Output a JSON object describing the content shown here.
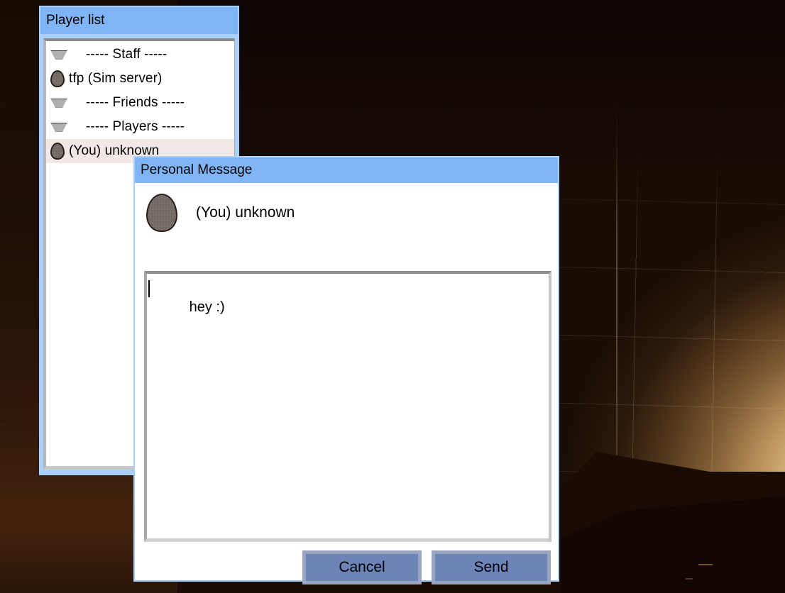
{
  "scene": {
    "description": "dark-brown-3d-room-with-warm-light",
    "colors": {
      "wall_dark": "#1b0d05",
      "wall_lit": "#efd8a8",
      "light_core": "#f7e6c0",
      "silhouette": "#1a0c05"
    }
  },
  "player_window": {
    "title": "Player list",
    "rows": [
      {
        "type": "group",
        "icon": "collapse-triangle-icon",
        "label": "----- Staff -----",
        "selected": false
      },
      {
        "type": "player",
        "icon": "avatar-head-icon",
        "label": "tfp (Sim server)",
        "selected": false
      },
      {
        "type": "group",
        "icon": "collapse-triangle-icon",
        "label": "----- Friends -----",
        "selected": false
      },
      {
        "type": "group",
        "icon": "collapse-triangle-icon",
        "label": "----- Players -----",
        "selected": false
      },
      {
        "type": "player",
        "icon": "avatar-head-icon",
        "label": "(You) unknown",
        "selected": true
      }
    ]
  },
  "personal_message": {
    "title": "Personal Message",
    "recipient": {
      "icon": "avatar-head-icon",
      "name": "(You) unknown"
    },
    "message": {
      "value": "hey :)",
      "placeholder": ""
    },
    "buttons": {
      "cancel": "Cancel",
      "send": "Send"
    }
  },
  "theme": {
    "titlebar_blue": "#7fb5f5",
    "window_frame_blue": "#a9cffb",
    "button_fill": "#6c84b8",
    "button_border": "#9aa5c1",
    "selection_highlight": "#f1e7e5"
  }
}
